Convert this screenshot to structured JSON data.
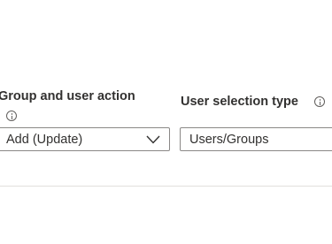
{
  "form": {
    "group_action": {
      "label": "Group and user action",
      "info_icon": "info-icon",
      "selected_value": "Add (Update)",
      "dropdown_icon": "chevron-down-icon"
    },
    "user_selection": {
      "label": "User selection type",
      "info_icon": "info-icon",
      "value": "Users/Groups"
    }
  },
  "colors": {
    "text": "#323130",
    "border": "#8a8886",
    "icon": "#605e5c",
    "divider": "#e1dfdd"
  }
}
